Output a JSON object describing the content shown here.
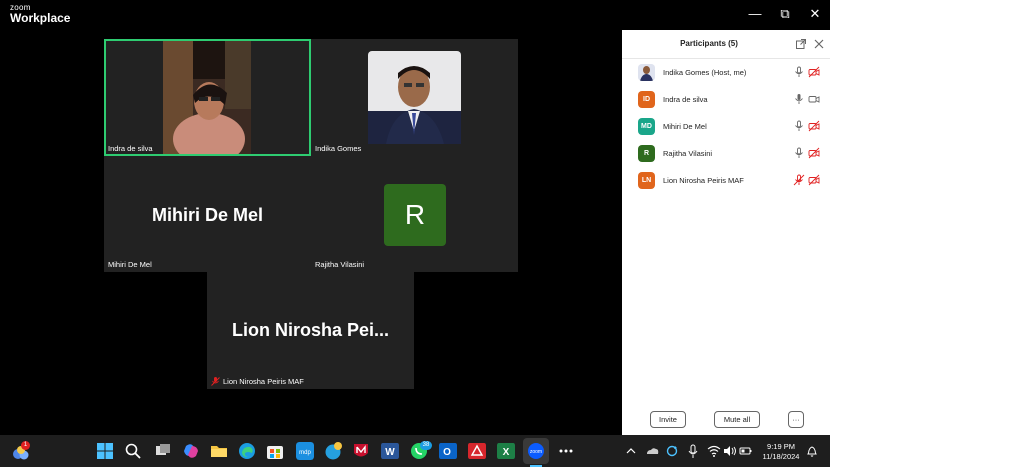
{
  "app": {
    "brand_small": "zoom",
    "brand_big": "Workplace"
  },
  "window_controls": {
    "minimize": "—",
    "restore": "⧉",
    "close": "✕"
  },
  "tiles": [
    {
      "name": "Indra de silva"
    },
    {
      "name": "Indika Gomes"
    },
    {
      "name": "Mihiri De Mel",
      "display": "Mihiri De Mel"
    },
    {
      "name": "Rajitha Vilasini",
      "initial": "R"
    },
    {
      "name": "Lion Nirosha Peiris MAF",
      "display": "Lion  Nirosha  Pei..."
    }
  ],
  "participants_panel": {
    "title": "Participants (5)",
    "items": [
      {
        "name": "Indika Gomes (Host, me)",
        "initials": "",
        "color": "#3a4a7a",
        "mic": "on",
        "video": "off"
      },
      {
        "name": "Indra de silva",
        "initials": "ID",
        "color": "#e0651c",
        "mic": "on",
        "video": "on"
      },
      {
        "name": "Mihiri De Mel",
        "initials": "MD",
        "color": "#1aa68a",
        "mic": "on",
        "video": "off"
      },
      {
        "name": "Rajitha Vilasini",
        "initials": "R",
        "color": "#2e6b1e",
        "mic": "on",
        "video": "off"
      },
      {
        "name": "Lion Nirosha Peiris MAF",
        "initials": "LN",
        "color": "#e0651c",
        "mic": "off",
        "video": "off"
      }
    ],
    "buttons": {
      "invite": "Invite",
      "mute_all": "Mute all",
      "more": "···"
    }
  },
  "taskbar": {
    "widgets_badge": "1",
    "whatsapp_badge": "38",
    "time": "9:19 PM",
    "date": "11/18/2024"
  },
  "colors": {
    "active_speaker_border": "#2ecc71",
    "muted_red": "#e02020",
    "tile_bg": "#222222"
  }
}
